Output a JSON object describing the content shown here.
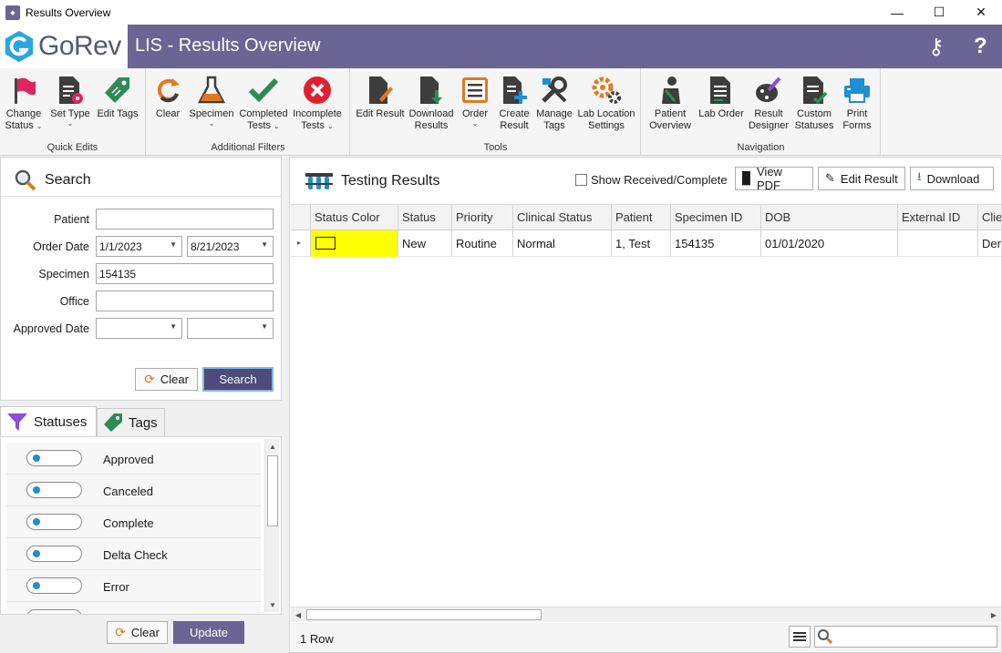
{
  "window": {
    "title": "Results Overview",
    "app_icon_text": "GoRev",
    "minimize": "—",
    "maximize": "☐",
    "close": "✕"
  },
  "header": {
    "brand": "GoRev",
    "title": "LIS - Results Overview",
    "bg_color": "#6b6594"
  },
  "ribbon": {
    "groups": [
      {
        "name": "Quick Edits",
        "tools": [
          {
            "label1": "Change",
            "label2": "Status",
            "dropdown": true
          },
          {
            "label1": "Set Type",
            "label2": "",
            "dropdown": true
          },
          {
            "label1": "Edit Tags",
            "label2": ""
          }
        ]
      },
      {
        "name": "Additional Filters",
        "tools": [
          {
            "label1": "Clear",
            "label2": ""
          },
          {
            "label1": "Specimen",
            "label2": "",
            "dropdown": true
          },
          {
            "label1": "Completed",
            "label2": "Tests",
            "dropdown": true
          },
          {
            "label1": "Incomplete",
            "label2": "Tests",
            "dropdown": true
          }
        ]
      },
      {
        "name": "Tools",
        "tools": [
          {
            "label1": "Edit Result",
            "label2": ""
          },
          {
            "label1": "Download",
            "label2": "Results"
          },
          {
            "label1": "Order",
            "label2": "",
            "dropdown": true
          },
          {
            "label1": "Create",
            "label2": "Result"
          },
          {
            "label1": "Manage",
            "label2": "Tags"
          },
          {
            "label1": "Lab Location",
            "label2": "Settings"
          }
        ]
      },
      {
        "name": "Navigation",
        "tools": [
          {
            "label1": "Patient",
            "label2": "Overview"
          },
          {
            "label1": "Lab Order",
            "label2": ""
          },
          {
            "label1": "Result",
            "label2": "Designer"
          },
          {
            "label1": "Custom",
            "label2": "Statuses"
          },
          {
            "label1": "Print",
            "label2": "Forms"
          }
        ]
      }
    ]
  },
  "search": {
    "title": "Search",
    "patient_label": "Patient",
    "patient_value": "",
    "order_date_label": "Order Date",
    "order_date_from": "1/1/2023",
    "order_date_to": "8/21/2023",
    "specimen_label": "Specimen",
    "specimen_value": "154135",
    "office_label": "Office",
    "office_value": "",
    "approved_date_label": "Approved Date",
    "approved_from": "",
    "approved_to": "",
    "clear_label": "Clear",
    "search_label": "Search"
  },
  "tabs": {
    "statuses": "Statuses",
    "tags": "Tags"
  },
  "statuses": [
    {
      "label": "Approved"
    },
    {
      "label": "Canceled"
    },
    {
      "label": "Complete"
    },
    {
      "label": "Delta Check"
    },
    {
      "label": "Error"
    }
  ],
  "left_footer": {
    "clear_label": "Clear",
    "update_label": "Update"
  },
  "results": {
    "title": "Testing Results",
    "show_received_label": "Show Received/Complete",
    "view_pdf_label": "View PDF",
    "edit_result_label": "Edit Result",
    "download_label": "Download",
    "columns": [
      "Status Color",
      "Status",
      "Priority",
      "Clinical Status",
      "Patient",
      "Specimen ID",
      "DOB",
      "External ID",
      "Clie"
    ],
    "rows": [
      {
        "status_color": "#ffff00",
        "status": "New",
        "priority": "Routine",
        "clinical_status": "Normal",
        "patient": "1, Test",
        "specimen_id": "154135",
        "dob": "01/01/2020",
        "external_id": "",
        "client": "Der"
      }
    ],
    "row_count": "1 Row",
    "search_value": ""
  }
}
